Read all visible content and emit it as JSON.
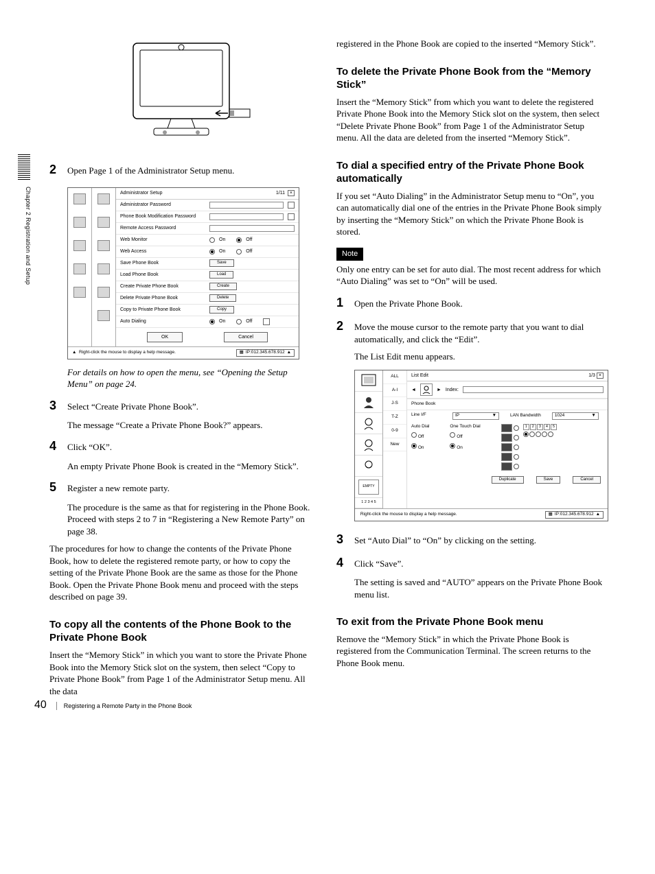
{
  "sidebar_label": "Chapter 2  Registration and Setup",
  "left": {
    "step2": "Open Page 1 of the Administrator Setup menu.",
    "admin": {
      "title": "Administrator Setup",
      "page_ind": "1/11",
      "rows": {
        "admin_pw": "Administrator Password",
        "pb_mod_pw": "Phone Book Modification Password",
        "remote_pw": "Remote Access Password",
        "web_monitor": "Web Monitor",
        "web_access": "Web Access",
        "save_pb": "Save Phone Book",
        "load_pb": "Load Phone Book",
        "create_ppb": "Create Private Phone Book",
        "delete_ppb": "Delete Private Phone Book",
        "copy_ppb": "Copy to Private Phone Book",
        "auto_dial": "Auto Dialing"
      },
      "opts": {
        "on": "On",
        "off": "Off"
      },
      "btns": {
        "save": "Save",
        "load": "Load",
        "create": "Create",
        "delete": "Delete",
        "copy": "Copy",
        "ok": "OK",
        "cancel": "Cancel"
      },
      "help": "Right-click the mouse to display a help message.",
      "ip": "IP:012.345.678.912"
    },
    "italic_note": "For details on how to open the menu, see “Opening the Setup Menu” on page 24.",
    "step3": "Select “Create Private Phone Book”.",
    "step3_sub": "The message “Create a Private Phone Book?” appears.",
    "step4": "Click “OK”.",
    "step4_sub": "An empty Private Phone Book is created in the “Memory Stick”.",
    "step5": "Register a new remote party.",
    "step5_sub": "The procedure is the same as that for registering in the Phone Book. Proceed with steps 2 to 7 in “Registering a New Remote Party” on page 38.",
    "para_after": "The procedures for how to change the contents of the Private Phone Book, how to delete the registered remote party, or how to copy the setting of the Private Phone Book are the same as those for the Phone Book. Open the Private Phone Book menu and proceed with the steps described on page 39.",
    "h_copy": "To copy all the contents of the Phone Book to the Private Phone Book",
    "p_copy": "Insert the “Memory Stick” in which you want to store the Private Phone Book into the Memory Stick slot on the system, then select “Copy to Private Phone Book” from Page 1 of the Administrator Setup menu. All the data"
  },
  "right": {
    "top_para": "registered in the Phone Book are copied to the inserted “Memory Stick”.",
    "h_delete": "To delete the Private Phone Book from the “Memory Stick”",
    "p_delete": "Insert the “Memory Stick” from which you want to delete the registered Private Phone Book into the Memory Stick slot on the system, then select “Delete Private Phone Book” from Page 1 of the Administrator Setup menu. All the data are deleted from the inserted “Memory Stick”.",
    "h_dial": "To dial a specified entry of the Private Phone Book automatically",
    "p_dial": "If you set “Auto Dialing” in the Administrator Setup menu to “On”, you can automatically dial one of the entries in the Private Phone Book simply by inserting the “Memory Stick” on which the Private Phone Book is stored.",
    "note_label": "Note",
    "note_body": "Only one entry can be set for auto dial. The most recent address for which “Auto Dialing” was set to “On” will be used.",
    "r_step1": "Open the Private Phone Book.",
    "r_step2": "Move the mouse cursor to the remote party that you want to dial automatically, and click the “Edit”.",
    "r_step2_sub": "The List Edit menu appears.",
    "listedit": {
      "title": "List Edit",
      "page_ind": "1/3",
      "tabs": [
        "ALL",
        "A-I",
        "J-S",
        "T-Z",
        "0-9",
        "New"
      ],
      "index_lbl": "Index:",
      "phonebook_lbl": "Phone Book",
      "line_lbl": "Line I/F",
      "line_val": "IP",
      "lan_lbl": "LAN Bandwidth",
      "lan_val": "1024",
      "autodial_lbl": "Auto Dial",
      "onetouch_lbl": "One Touch Dial",
      "off": "Off",
      "on": "On",
      "empty_lbl": "EMPTY",
      "btns": {
        "dup": "Duplicate",
        "save": "Save",
        "cancel": "Cancel"
      },
      "help": "Right-click the mouse to display a help message.",
      "ip": "IP:012.345.678.912"
    },
    "r_step3": "Set “Auto Dial” to “On” by clicking on the setting.",
    "r_step4": "Click “Save”.",
    "r_step4_sub": "The setting is saved and “AUTO” appears on the Private Phone Book menu list.",
    "h_exit": "To exit from the Private Phone Book menu",
    "p_exit": "Remove the “Memory Stick” in which the Private Phone Book is registered from the Communication Terminal. The screen returns to the Phone Book menu."
  },
  "footer": {
    "page": "40",
    "title": "Registering a Remote Party in the Phone Book"
  }
}
